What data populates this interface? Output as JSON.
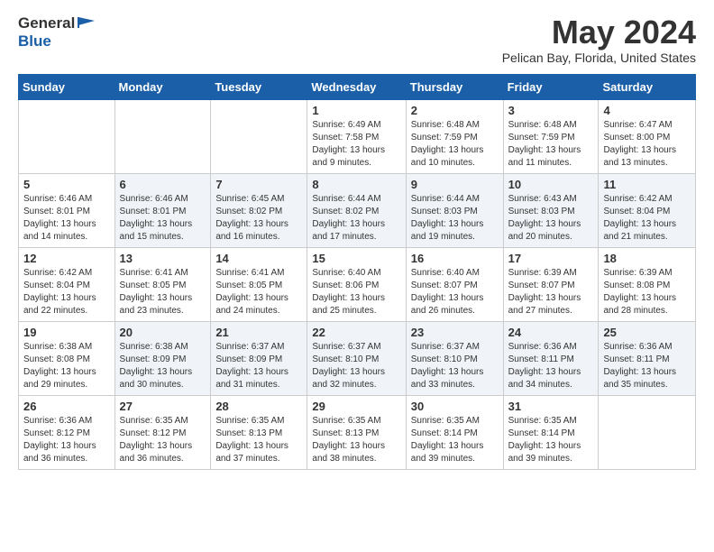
{
  "header": {
    "logo_general": "General",
    "logo_blue": "Blue",
    "title": "May 2024",
    "location": "Pelican Bay, Florida, United States"
  },
  "weekdays": [
    "Sunday",
    "Monday",
    "Tuesday",
    "Wednesday",
    "Thursday",
    "Friday",
    "Saturday"
  ],
  "weeks": [
    [
      {
        "day": "",
        "info": ""
      },
      {
        "day": "",
        "info": ""
      },
      {
        "day": "",
        "info": ""
      },
      {
        "day": "1",
        "info": "Sunrise: 6:49 AM\nSunset: 7:58 PM\nDaylight: 13 hours\nand 9 minutes."
      },
      {
        "day": "2",
        "info": "Sunrise: 6:48 AM\nSunset: 7:59 PM\nDaylight: 13 hours\nand 10 minutes."
      },
      {
        "day": "3",
        "info": "Sunrise: 6:48 AM\nSunset: 7:59 PM\nDaylight: 13 hours\nand 11 minutes."
      },
      {
        "day": "4",
        "info": "Sunrise: 6:47 AM\nSunset: 8:00 PM\nDaylight: 13 hours\nand 13 minutes."
      }
    ],
    [
      {
        "day": "5",
        "info": "Sunrise: 6:46 AM\nSunset: 8:01 PM\nDaylight: 13 hours\nand 14 minutes."
      },
      {
        "day": "6",
        "info": "Sunrise: 6:46 AM\nSunset: 8:01 PM\nDaylight: 13 hours\nand 15 minutes."
      },
      {
        "day": "7",
        "info": "Sunrise: 6:45 AM\nSunset: 8:02 PM\nDaylight: 13 hours\nand 16 minutes."
      },
      {
        "day": "8",
        "info": "Sunrise: 6:44 AM\nSunset: 8:02 PM\nDaylight: 13 hours\nand 17 minutes."
      },
      {
        "day": "9",
        "info": "Sunrise: 6:44 AM\nSunset: 8:03 PM\nDaylight: 13 hours\nand 19 minutes."
      },
      {
        "day": "10",
        "info": "Sunrise: 6:43 AM\nSunset: 8:03 PM\nDaylight: 13 hours\nand 20 minutes."
      },
      {
        "day": "11",
        "info": "Sunrise: 6:42 AM\nSunset: 8:04 PM\nDaylight: 13 hours\nand 21 minutes."
      }
    ],
    [
      {
        "day": "12",
        "info": "Sunrise: 6:42 AM\nSunset: 8:04 PM\nDaylight: 13 hours\nand 22 minutes."
      },
      {
        "day": "13",
        "info": "Sunrise: 6:41 AM\nSunset: 8:05 PM\nDaylight: 13 hours\nand 23 minutes."
      },
      {
        "day": "14",
        "info": "Sunrise: 6:41 AM\nSunset: 8:05 PM\nDaylight: 13 hours\nand 24 minutes."
      },
      {
        "day": "15",
        "info": "Sunrise: 6:40 AM\nSunset: 8:06 PM\nDaylight: 13 hours\nand 25 minutes."
      },
      {
        "day": "16",
        "info": "Sunrise: 6:40 AM\nSunset: 8:07 PM\nDaylight: 13 hours\nand 26 minutes."
      },
      {
        "day": "17",
        "info": "Sunrise: 6:39 AM\nSunset: 8:07 PM\nDaylight: 13 hours\nand 27 minutes."
      },
      {
        "day": "18",
        "info": "Sunrise: 6:39 AM\nSunset: 8:08 PM\nDaylight: 13 hours\nand 28 minutes."
      }
    ],
    [
      {
        "day": "19",
        "info": "Sunrise: 6:38 AM\nSunset: 8:08 PM\nDaylight: 13 hours\nand 29 minutes."
      },
      {
        "day": "20",
        "info": "Sunrise: 6:38 AM\nSunset: 8:09 PM\nDaylight: 13 hours\nand 30 minutes."
      },
      {
        "day": "21",
        "info": "Sunrise: 6:37 AM\nSunset: 8:09 PM\nDaylight: 13 hours\nand 31 minutes."
      },
      {
        "day": "22",
        "info": "Sunrise: 6:37 AM\nSunset: 8:10 PM\nDaylight: 13 hours\nand 32 minutes."
      },
      {
        "day": "23",
        "info": "Sunrise: 6:37 AM\nSunset: 8:10 PM\nDaylight: 13 hours\nand 33 minutes."
      },
      {
        "day": "24",
        "info": "Sunrise: 6:36 AM\nSunset: 8:11 PM\nDaylight: 13 hours\nand 34 minutes."
      },
      {
        "day": "25",
        "info": "Sunrise: 6:36 AM\nSunset: 8:11 PM\nDaylight: 13 hours\nand 35 minutes."
      }
    ],
    [
      {
        "day": "26",
        "info": "Sunrise: 6:36 AM\nSunset: 8:12 PM\nDaylight: 13 hours\nand 36 minutes."
      },
      {
        "day": "27",
        "info": "Sunrise: 6:35 AM\nSunset: 8:12 PM\nDaylight: 13 hours\nand 36 minutes."
      },
      {
        "day": "28",
        "info": "Sunrise: 6:35 AM\nSunset: 8:13 PM\nDaylight: 13 hours\nand 37 minutes."
      },
      {
        "day": "29",
        "info": "Sunrise: 6:35 AM\nSunset: 8:13 PM\nDaylight: 13 hours\nand 38 minutes."
      },
      {
        "day": "30",
        "info": "Sunrise: 6:35 AM\nSunset: 8:14 PM\nDaylight: 13 hours\nand 39 minutes."
      },
      {
        "day": "31",
        "info": "Sunrise: 6:35 AM\nSunset: 8:14 PM\nDaylight: 13 hours\nand 39 minutes."
      },
      {
        "day": "",
        "info": ""
      }
    ]
  ]
}
